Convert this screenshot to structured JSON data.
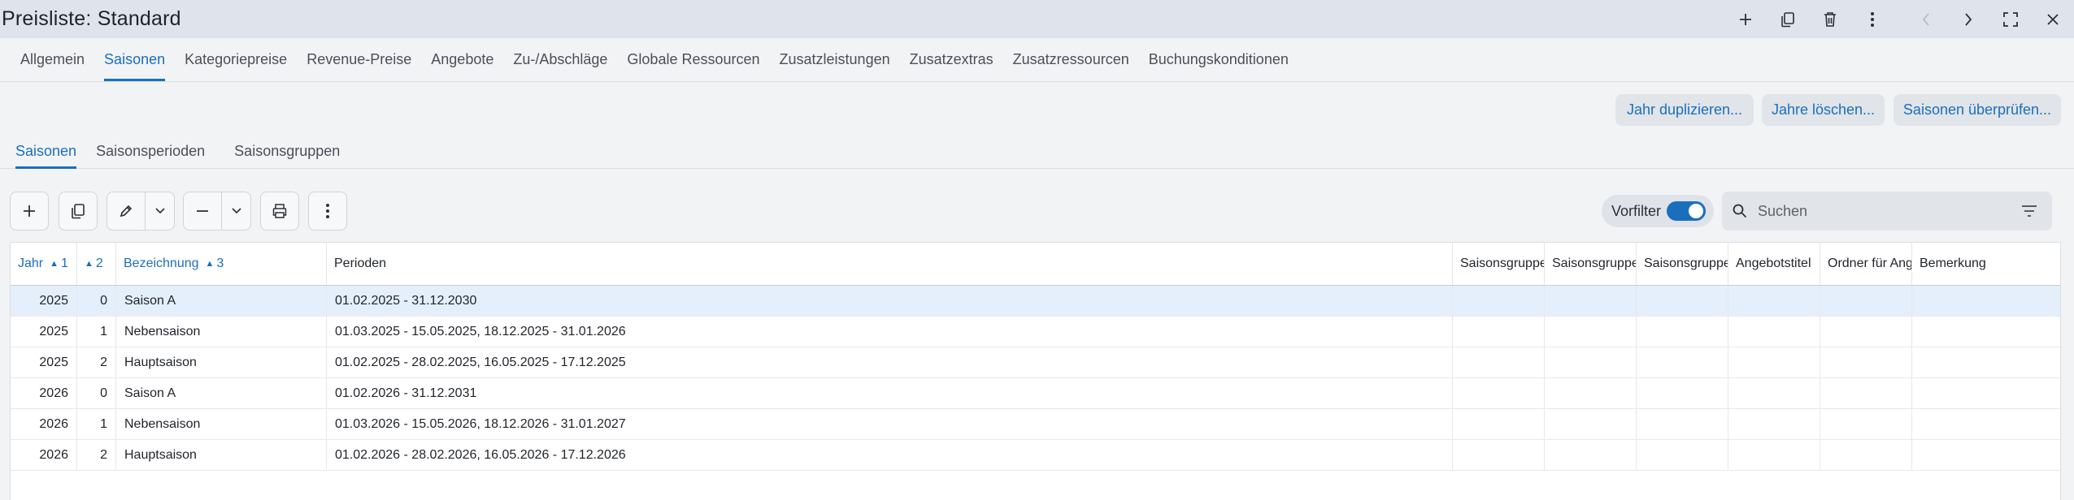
{
  "window": {
    "title": "Preisliste: Standard"
  },
  "main_tabs": [
    {
      "label": "Allgemein",
      "active": false
    },
    {
      "label": "Saisonen",
      "active": true
    },
    {
      "label": "Kategoriepreise",
      "active": false
    },
    {
      "label": "Revenue-Preise",
      "active": false
    },
    {
      "label": "Angebote",
      "active": false
    },
    {
      "label": "Zu-/Abschläge",
      "active": false
    },
    {
      "label": "Globale Ressourcen",
      "active": false
    },
    {
      "label": "Zusatzleistungen",
      "active": false
    },
    {
      "label": "Zusatzextras",
      "active": false
    },
    {
      "label": "Zusatzressourcen",
      "active": false
    },
    {
      "label": "Buchungskonditionen",
      "active": false
    }
  ],
  "actions": {
    "duplicate_year": "Jahr duplizieren...",
    "delete_years": "Jahre löschen...",
    "check_seasons": "Saisonen überprüfen..."
  },
  "sub_tabs": [
    {
      "label": "Saisonen",
      "active": true
    },
    {
      "label": "Saisonsperioden",
      "active": false
    },
    {
      "label": "Saisonsgruppen",
      "active": false
    }
  ],
  "toolbar": {
    "prefilter_label": "Vorfilter",
    "prefilter_on": true,
    "search_placeholder": "Suchen"
  },
  "table": {
    "columns": [
      {
        "label": "Jahr",
        "sort": "1",
        "sorted": true
      },
      {
        "label": "",
        "sort": "2",
        "sorted": true
      },
      {
        "label": "Bezeichnung",
        "sort": "3",
        "sorted": true
      },
      {
        "label": "Perioden",
        "sort": "",
        "sorted": false
      },
      {
        "label": "Saisonsgruppe",
        "sort": "",
        "sorted": false
      },
      {
        "label": "Saisonsgruppe",
        "sort": "",
        "sorted": false
      },
      {
        "label": "Saisonsgruppe",
        "sort": "",
        "sorted": false
      },
      {
        "label": "Angebotstitel",
        "sort": "",
        "sorted": false
      },
      {
        "label": "Ordner für Angebote",
        "sort": "",
        "sorted": false
      },
      {
        "label": "Bemerkung",
        "sort": "",
        "sorted": false
      }
    ],
    "rows": [
      {
        "year": "2025",
        "index": "0",
        "name": "Saison A",
        "periods": "01.02.2025 - 31.12.2030",
        "selected": true
      },
      {
        "year": "2025",
        "index": "1",
        "name": "Nebensaison",
        "periods": "01.03.2025 - 15.05.2025, 18.12.2025 - 31.01.2026",
        "selected": false
      },
      {
        "year": "2025",
        "index": "2",
        "name": "Hauptsaison",
        "periods": "01.02.2025 - 28.02.2025, 16.05.2025 - 17.12.2025",
        "selected": false
      },
      {
        "year": "2026",
        "index": "0",
        "name": "Saison A",
        "periods": "01.02.2026 - 31.12.2031",
        "selected": false
      },
      {
        "year": "2026",
        "index": "1",
        "name": "Nebensaison",
        "periods": "01.03.2026 - 15.05.2026, 18.12.2026 - 31.01.2027",
        "selected": false
      },
      {
        "year": "2026",
        "index": "2",
        "name": "Hauptsaison",
        "periods": "01.02.2026 - 28.02.2026, 16.05.2026 - 17.12.2026",
        "selected": false
      }
    ]
  },
  "colors": {
    "accent": "#1a6fbd",
    "titlebar": "#dfe4ec",
    "selected_row": "#e4effb"
  }
}
